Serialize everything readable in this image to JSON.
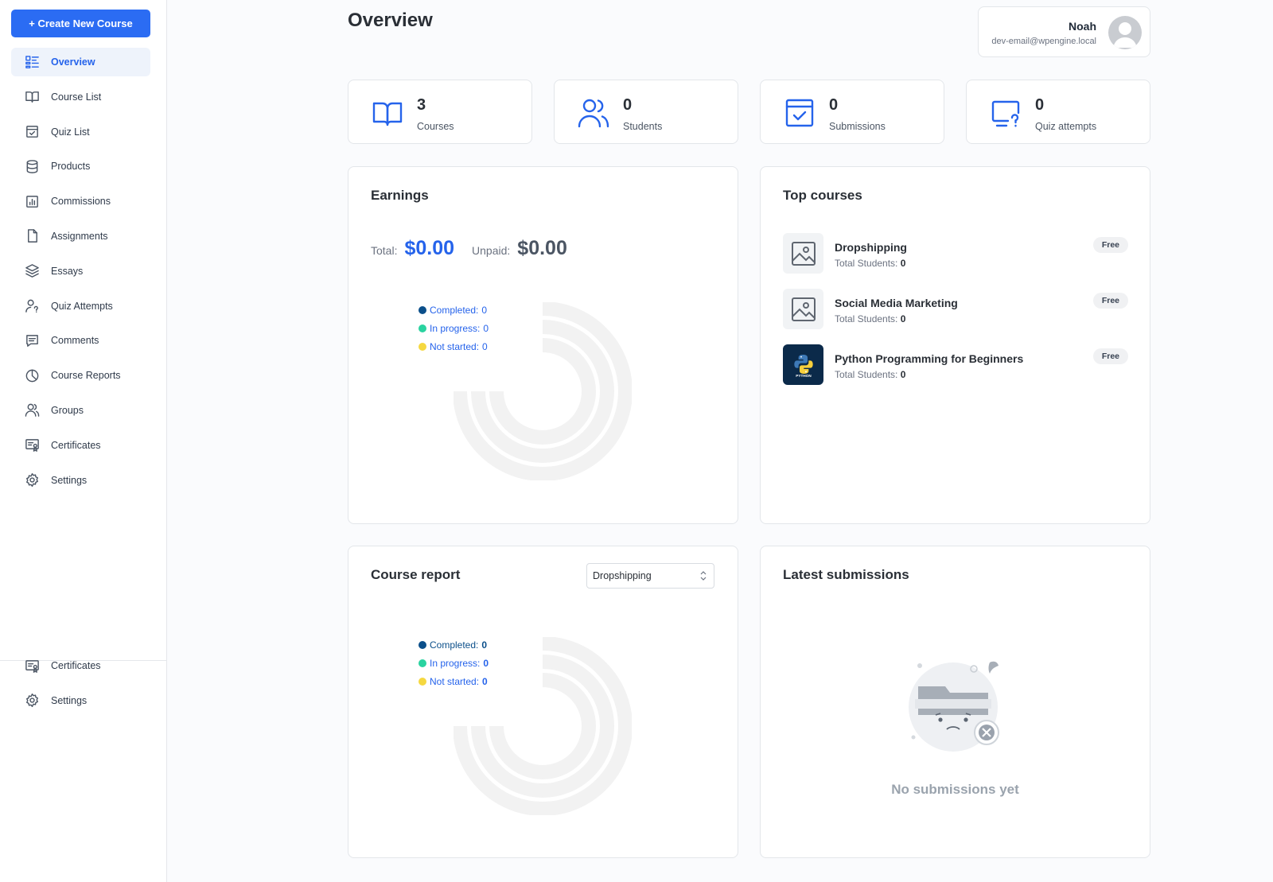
{
  "sidebar": {
    "create_button": "+ Create New Course",
    "items": [
      {
        "label": "Overview",
        "icon": "overview-icon",
        "active": true
      },
      {
        "label": "Course List",
        "icon": "book-open-icon"
      },
      {
        "label": "Quiz List",
        "icon": "calendar-check-icon"
      },
      {
        "label": "Products",
        "icon": "database-icon"
      },
      {
        "label": "Commissions",
        "icon": "bar-chart-icon"
      },
      {
        "label": "Assignments",
        "icon": "document-icon"
      },
      {
        "label": "Essays",
        "icon": "layers-icon"
      },
      {
        "label": "Quiz Attempts",
        "icon": "user-question-icon"
      },
      {
        "label": "Comments",
        "icon": "comment-icon"
      },
      {
        "label": "Course Reports",
        "icon": "pie-chart-icon"
      },
      {
        "label": "Groups",
        "icon": "users-icon"
      },
      {
        "label": "Certificates",
        "icon": "certificate-icon"
      },
      {
        "label": "Settings",
        "icon": "gear-icon"
      }
    ],
    "bottom_items": [
      {
        "label": "Certificates",
        "icon": "certificate-icon"
      },
      {
        "label": "Settings",
        "icon": "gear-icon"
      }
    ]
  },
  "header": {
    "title": "Overview",
    "user": {
      "name": "Noah",
      "email": "dev-email@wpengine.local"
    }
  },
  "stats": [
    {
      "value": "3",
      "label": "Courses",
      "icon": "book-open-icon"
    },
    {
      "value": "0",
      "label": "Students",
      "icon": "users-icon"
    },
    {
      "value": "0",
      "label": "Submissions",
      "icon": "calendar-check-icon"
    },
    {
      "value": "0",
      "label": "Quiz attempts",
      "icon": "monitor-question-icon"
    }
  ],
  "earnings": {
    "title": "Earnings",
    "total_label": "Total:",
    "total_value": "$0.00",
    "unpaid_label": "Unpaid:",
    "unpaid_value": "$0.00",
    "legend": [
      {
        "label": "Completed:",
        "value": "0",
        "color": "#0b4f8a"
      },
      {
        "label": "In progress:",
        "value": "0",
        "color": "#2ad3a0"
      },
      {
        "label": "Not started:",
        "value": "0",
        "color": "#f5d840"
      }
    ]
  },
  "top_courses": {
    "title": "Top courses",
    "students_label": "Total Students:",
    "items": [
      {
        "name": "Dropshipping",
        "students": "0",
        "badge": "Free",
        "thumb": "image-placeholder-icon"
      },
      {
        "name": "Social Media Marketing",
        "students": "0",
        "badge": "Free",
        "thumb": "image-placeholder-icon"
      },
      {
        "name": "Python Programming for Beginners",
        "students": "0",
        "badge": "Free",
        "thumb": "python-logo-icon",
        "thumb_text": "PYTHON"
      }
    ]
  },
  "course_report": {
    "title": "Course report",
    "selected": "Dropshipping",
    "legend": [
      {
        "label": "Completed:",
        "value": "0",
        "color": "#0b4f8a"
      },
      {
        "label": "In progress:",
        "value": "0",
        "color": "#2ad3a0"
      },
      {
        "label": "Not started:",
        "value": "0",
        "color": "#f5d840"
      }
    ]
  },
  "latest_submissions": {
    "title": "Latest submissions",
    "empty_text": "No submissions yet"
  },
  "colors": {
    "accent": "#2b6cf3",
    "ring": "#f2f2f2"
  }
}
